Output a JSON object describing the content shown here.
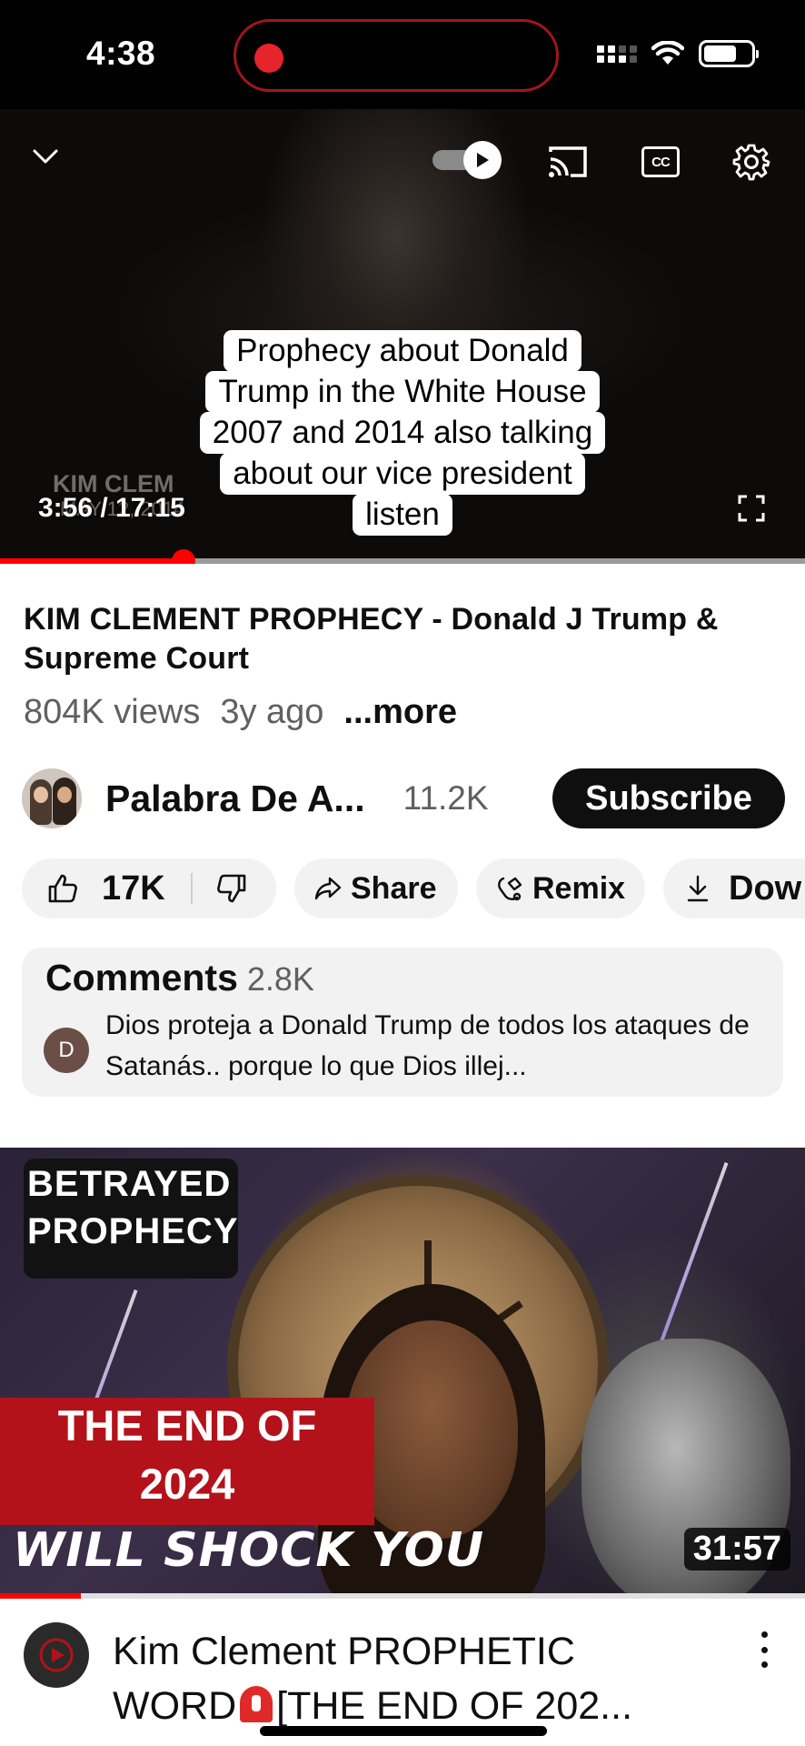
{
  "status_bar": {
    "time": "4:38"
  },
  "player": {
    "current_time": "3:56 / 17:15",
    "watermark": "KIM CLEM",
    "watermark_sub": "MAY 12, 2014",
    "progress_fraction": 0.228,
    "caption_lines": [
      "Prophecy about Donald",
      "Trump in the White House",
      "2007 and 2014 also talking",
      "about our vice president",
      "listen"
    ],
    "icons": [
      "chevron-down-icon",
      "autoplay-toggle",
      "cast-icon",
      "cc-icon",
      "settings-gear-icon",
      "fullscreen-icon"
    ],
    "cc_label": "CC"
  },
  "video": {
    "title": "KIM CLEMENT PROPHECY - Donald J Trump & Supreme Court",
    "views": "804K views",
    "age": "3y ago",
    "more_label": "...more"
  },
  "channel": {
    "name": "Palabra De A...",
    "subscribers": "11.2K",
    "subscribe_label": "Subscribe"
  },
  "actions": {
    "likes": "17K",
    "share_label": "Share",
    "remix_label": "Remix",
    "download_label": "Dow"
  },
  "comments": {
    "title": "Comments",
    "count": "2.8K",
    "avatar_letter": "D",
    "top_comment": "Dios proteja a Donald Trump de todos los ataques de Satanás.. porque lo que Dios illej..."
  },
  "next_video": {
    "thumb_text_1": "BETRAYED",
    "thumb_text_2": "PROPHECY",
    "thumb_text_3": "THE END OF",
    "thumb_text_4": "2024",
    "thumb_text_5": "WILL SHOCK YOU",
    "duration": "31:57",
    "progress_fraction": 0.1,
    "title_line1": "Kim Clement PROPHETIC",
    "title_line2_a": "WORD",
    "title_line2_b": "[THE END OF 202..."
  },
  "colors": {
    "accent_red": "#ff0000",
    "recording_red": "#e5242b",
    "text_primary": "#0f0f0f",
    "text_secondary": "#606060",
    "pill_bg": "#f2f2f2"
  }
}
